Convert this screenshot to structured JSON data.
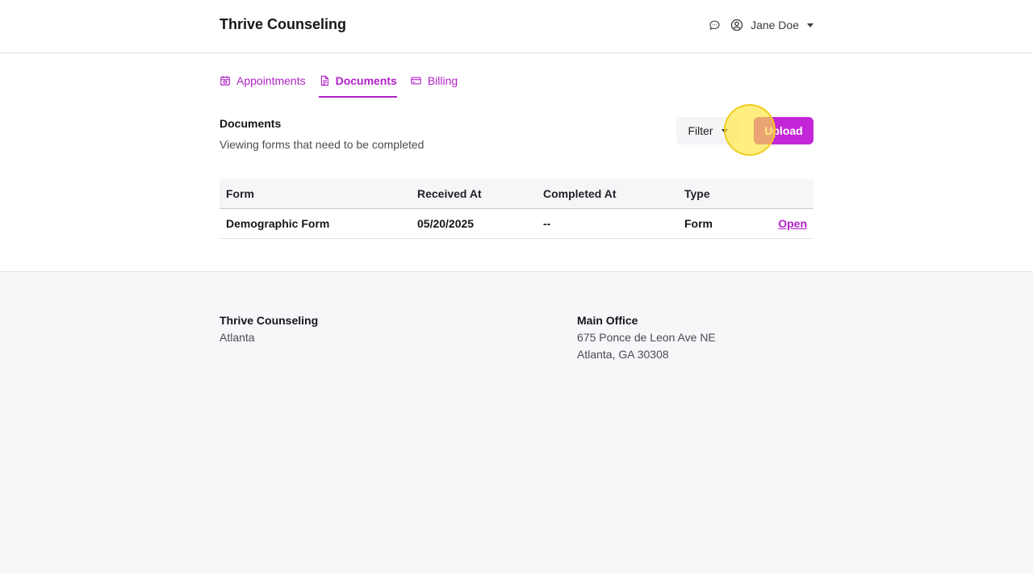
{
  "header": {
    "brand": "Thrive Counseling",
    "user_name": "Jane Doe"
  },
  "tabs": [
    {
      "label": "Appointments",
      "icon": "calendar-icon",
      "active": false
    },
    {
      "label": "Documents",
      "icon": "document-icon",
      "active": true
    },
    {
      "label": "Billing",
      "icon": "credit-card-icon",
      "active": false
    }
  ],
  "section": {
    "title": "Documents",
    "subtitle": "Viewing forms that need to be completed"
  },
  "actions": {
    "filter_label": "Filter",
    "upload_label": "Upload"
  },
  "table": {
    "columns": [
      "Form",
      "Received At",
      "Completed At",
      "Type"
    ],
    "rows": [
      {
        "form": "Demographic Form",
        "received_at": "05/20/2025",
        "completed_at": "--",
        "type": "Form",
        "action": "Open"
      }
    ]
  },
  "footer": {
    "left": {
      "name": "Thrive Counseling",
      "city": "Atlanta"
    },
    "right": {
      "title": "Main Office",
      "line1": "675 Ponce de Leon Ave NE",
      "line2": "Atlanta, GA 30308"
    }
  },
  "colors": {
    "accent": "#c326d6",
    "accent_text": "#b022c6",
    "footer_bg": "#f6f7f9"
  }
}
